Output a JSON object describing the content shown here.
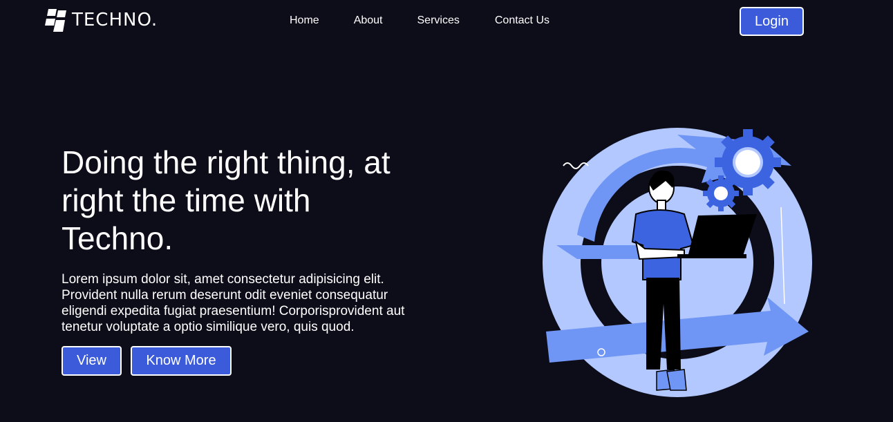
{
  "brand": {
    "name": "TECHNO."
  },
  "nav": {
    "items": [
      {
        "label": "Home"
      },
      {
        "label": "About"
      },
      {
        "label": "Services"
      },
      {
        "label": "Contact Us"
      }
    ]
  },
  "header": {
    "login_label": "Login"
  },
  "hero": {
    "title": "Doing the right thing, at right the time with Techno.",
    "description": "Lorem ipsum dolor sit, amet consectetur adipisicing elit. Provident nulla rerum deserunt odit eveniet consequatur eligendi expedita fugiat praesentium! Corporisprovident aut tenetur voluptate a optio similique vero, quis quod.",
    "buttons": {
      "view_label": "View",
      "know_more_label": "Know More"
    }
  },
  "colors": {
    "background": "#0d0d1a",
    "accent": "#3b5bdb",
    "illustration_light": "#b3c8ff",
    "illustration_mid": "#6f95f5",
    "illustration_dark": "#3c64e0"
  },
  "icons": {
    "logo": "techno-logo-icon",
    "illustration": "person-with-laptop-gears-illustration"
  }
}
